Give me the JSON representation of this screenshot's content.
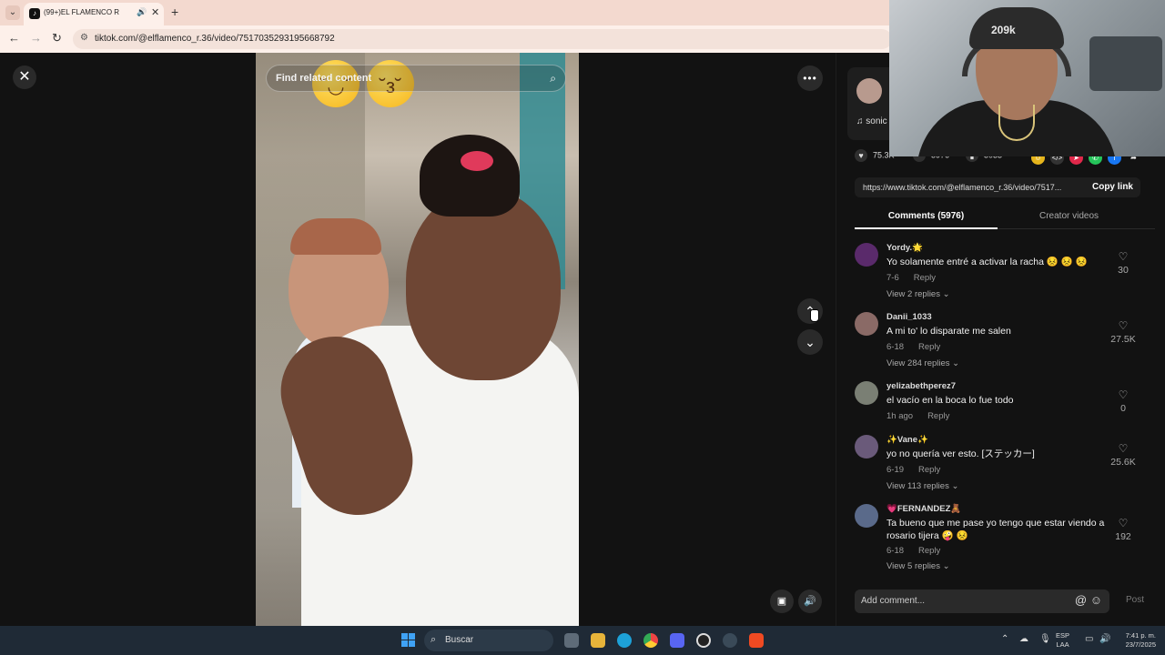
{
  "browser": {
    "tab_title": "(99+)EL FLAMENCO R",
    "url": "tiktok.com/@elflamenco_r.36/video/7517035293195668792"
  },
  "video": {
    "search_placeholder": "Find related content"
  },
  "panel": {
    "music_text": "sonic",
    "stats": {
      "likes": "75.3K",
      "comments": "5976",
      "saves": "5033"
    },
    "share_link": "https://www.tiktok.com/@elflamenco_r.36/video/7517...",
    "copy_link": "Copy link",
    "tabs": {
      "comments": "Comments (5976)",
      "creator": "Creator videos"
    },
    "add_comment_placeholder": "Add comment...",
    "post": "Post"
  },
  "comments": [
    {
      "user": "Yordy.🌟",
      "text": "Yo solamente entré a activar la racha 😣 😣 😣",
      "date": "7-6",
      "reply": "Reply",
      "likes": "30",
      "replies": "View 2 replies",
      "avatar_color": "#5a2a6b"
    },
    {
      "user": "Danii_1033",
      "text": "A mi to' lo disparate me salen",
      "date": "6-18",
      "reply": "Reply",
      "likes": "27.5K",
      "replies": "View 284 replies",
      "avatar_color": "#8a6a66"
    },
    {
      "user": "yelizabethperez7",
      "text": "el vacío en la boca lo fue todo",
      "date": "1h ago",
      "reply": "Reply",
      "likes": "0",
      "replies": "",
      "avatar_color": "#7a7f74"
    },
    {
      "user": "✨Vane✨",
      "text": "yo no quería ver esto. [ステッカー]",
      "date": "6-19",
      "reply": "Reply",
      "likes": "25.6K",
      "replies": "View 113 replies",
      "avatar_color": "#6a5a7a"
    },
    {
      "user": "💗FERNANDEZ🧸",
      "text": "Ta bueno que me pase yo tengo que estar viendo a rosario tijera 🤪 😣",
      "date": "6-18",
      "reply": "Reply",
      "likes": "192",
      "replies": "View 5 replies",
      "avatar_color": "#5a6a8a"
    }
  ],
  "webcam": {
    "cap_text": "209k"
  },
  "taskbar": {
    "search": "Buscar",
    "lang_line1": "ESP",
    "lang_line2": "LAA",
    "time": "7:41 p. m.",
    "date": "23/7/2025"
  }
}
